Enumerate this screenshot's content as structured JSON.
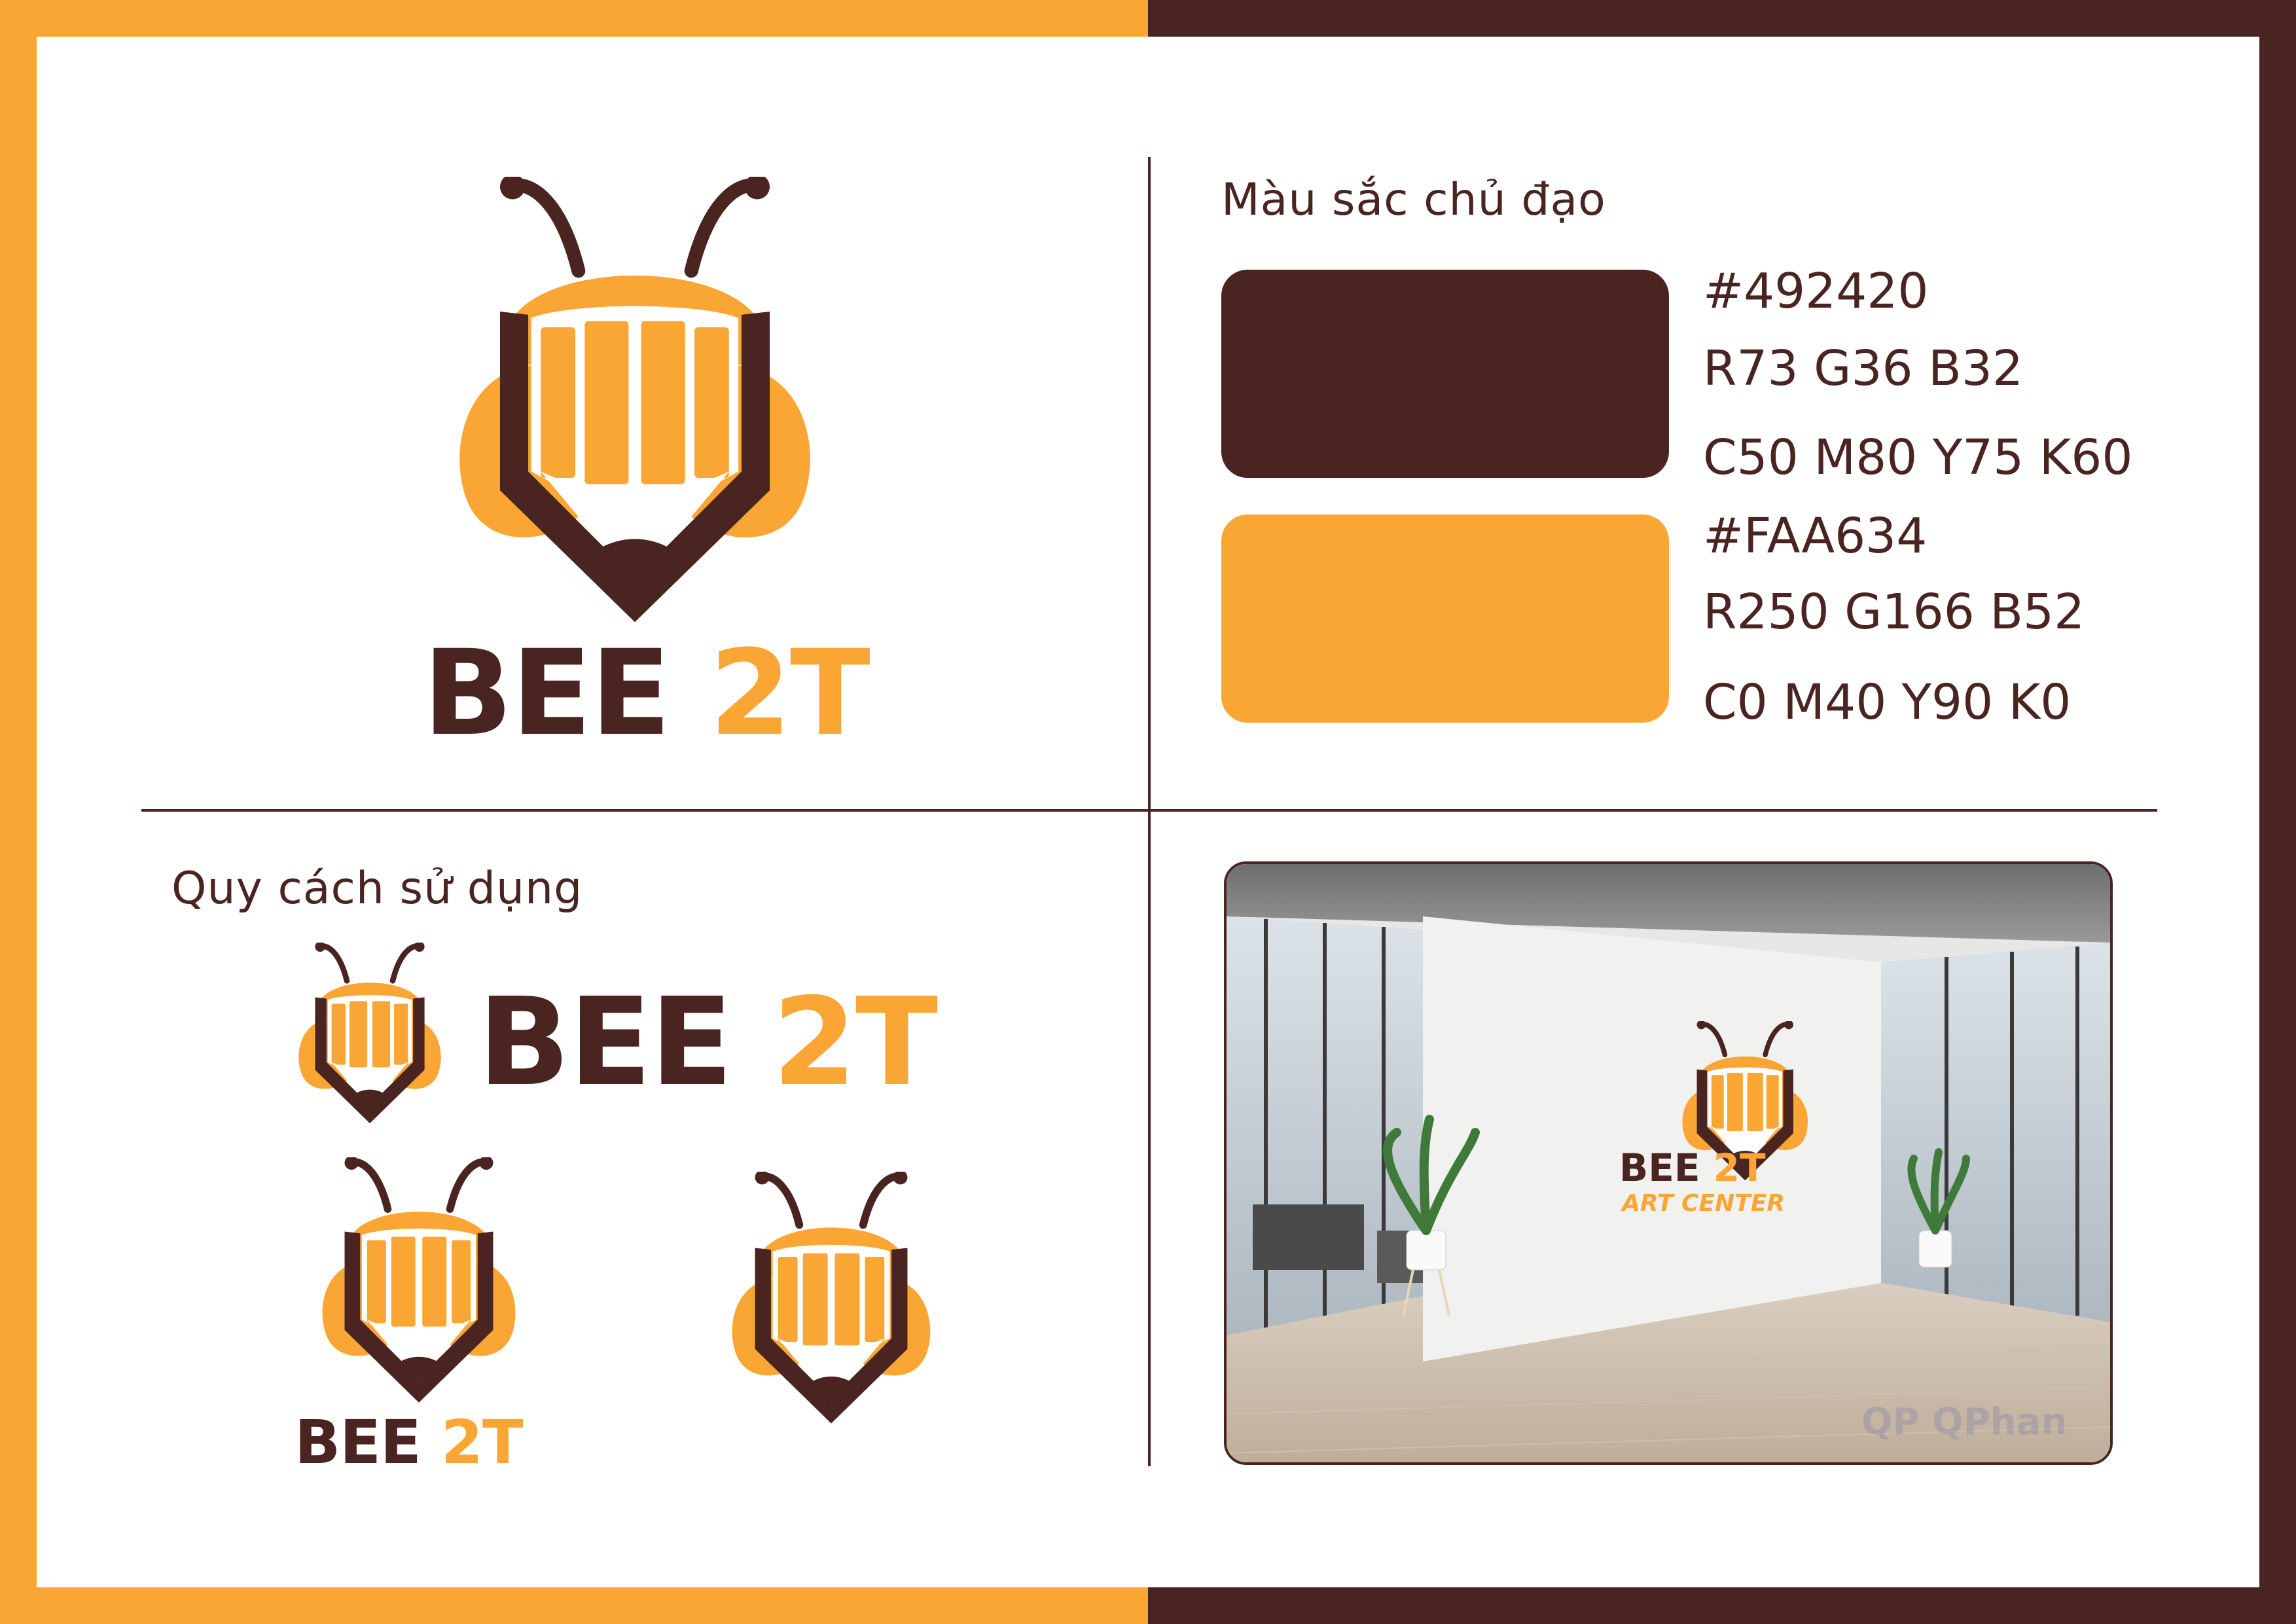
{
  "colors": {
    "brown": "#492420",
    "orange": "#FAA634",
    "white": "#FFFFFF"
  },
  "brand": {
    "word1": "BEE",
    "word2": "2T",
    "tagline": "ART CENTER"
  },
  "palette": {
    "title": "Màu sắc chủ đạo",
    "swatches": [
      {
        "hex": "#492420",
        "rgb": "R73 G36 B32",
        "cmyk": "C50 M80 Y75 K60"
      },
      {
        "hex": "#FAA634",
        "rgb": "R250 G166 B52",
        "cmyk": "C0 M40 Y90 K0"
      }
    ]
  },
  "usage": {
    "title": "Quy cách sử dụng"
  },
  "mockup": {
    "watermark": "QPhan",
    "watermark_mark": "QP"
  },
  "icons": [
    "bee-pencil-icon"
  ]
}
